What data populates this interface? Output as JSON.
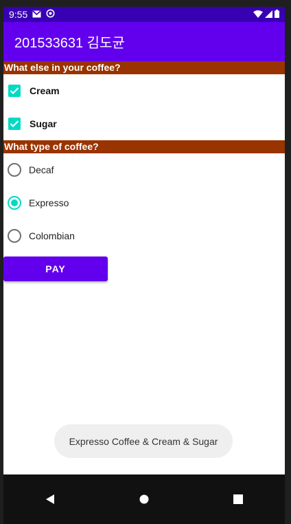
{
  "status_bar": {
    "time": "9:55",
    "left_icons": [
      "gmail-icon",
      "sync-icon"
    ],
    "right_icons": [
      "wifi-icon",
      "signal-icon",
      "battery-icon"
    ]
  },
  "app_bar": {
    "title": "201533631 김도균"
  },
  "toppings": {
    "header": "What else in your coffee?",
    "items": [
      {
        "label": "Cream",
        "checked": true
      },
      {
        "label": "Sugar",
        "checked": true
      }
    ]
  },
  "coffee_type": {
    "header": "What type of coffee?",
    "options": [
      {
        "label": "Decaf",
        "selected": false
      },
      {
        "label": "Expresso",
        "selected": true
      },
      {
        "label": "Colombian",
        "selected": false
      }
    ]
  },
  "pay_button": {
    "label": "PAY"
  },
  "toast": {
    "message": "Expresso Coffee & Cream & Sugar"
  },
  "colors": {
    "status_bar": "#3700b3",
    "app_bar": "#6200ee",
    "section_header": "#993300",
    "accent": "#03dac5"
  }
}
